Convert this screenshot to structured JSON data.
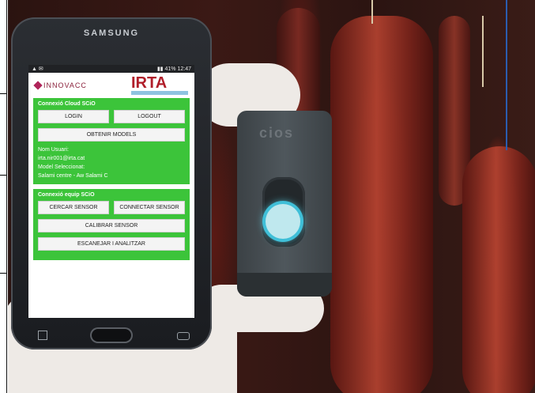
{
  "phone": {
    "brand": "SAMSUNG",
    "status_time": "12:47",
    "status_battery": "41%"
  },
  "logos": {
    "innovacc": "INNOVACC",
    "irta": "IRTA"
  },
  "cloud_panel": {
    "title": "Connexió Cloud SCiO",
    "login_label": "LOGIN",
    "logout_label": "LOGOUT",
    "obtain_models_label": "OBTENIR MODELS",
    "user_label": "Nom Usuari:",
    "user_value": "irta.nir001@irta.cat",
    "model_label": "Model Seleccionat:",
    "model_value": "Salami centre - Aw Salami C"
  },
  "device_panel": {
    "title": "Connexió equip SCiO",
    "search_sensor_label": "CERCAR SENSOR",
    "connect_sensor_label": "CONNECTAR SENSOR",
    "calibrate_label": "CALIBRAR SENSOR",
    "scan_label": "ESCANEJAR I ANALITZAR"
  },
  "scio_device": {
    "logo": "cios"
  },
  "colors": {
    "panel_green": "#3cc43a",
    "scio_ring": "#3fbfd8",
    "irta_red": "#b01e2a"
  }
}
